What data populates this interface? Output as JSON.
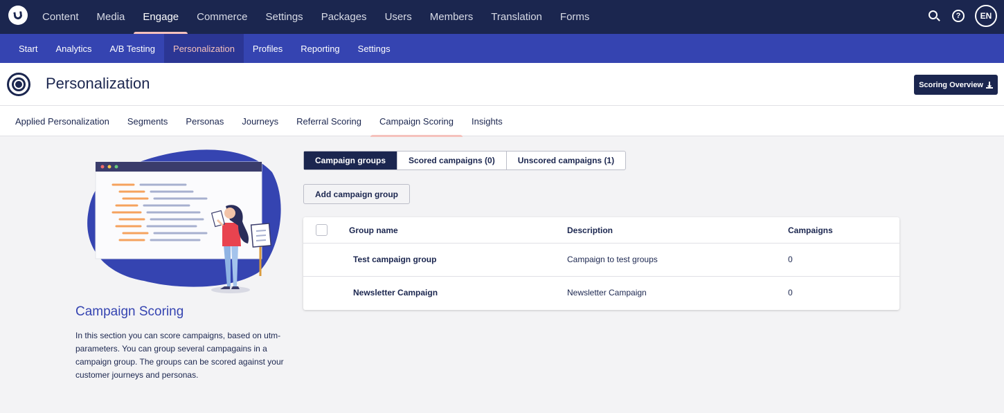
{
  "topnav": {
    "items": [
      "Content",
      "Media",
      "Engage",
      "Commerce",
      "Settings",
      "Packages",
      "Users",
      "Members",
      "Translation",
      "Forms"
    ],
    "active": "Engage",
    "help_glyph": "?",
    "user_initials": "EN"
  },
  "subnav": {
    "items": [
      "Start",
      "Analytics",
      "A/B Testing",
      "Personalization",
      "Profiles",
      "Reporting",
      "Settings"
    ],
    "active": "Personalization"
  },
  "header": {
    "title": "Personalization",
    "scoring_button": "Scoring Overview",
    "icon": "target-icon"
  },
  "tabs": {
    "items": [
      "Applied Personalization",
      "Segments",
      "Personas",
      "Journeys",
      "Referral Scoring",
      "Campaign Scoring",
      "Insights"
    ],
    "active": "Campaign Scoring"
  },
  "side": {
    "title": "Campaign Scoring",
    "description": "In this section you can score campaigns, based on utm-parameters. You can group several campagains in a campaign group. The groups can be scored against your customer journeys and personas."
  },
  "segments": {
    "items": [
      "Campaign groups",
      "Scored campaigns (0)",
      "Unscored campaigns (1)"
    ],
    "active": "Campaign groups"
  },
  "add_button": "Add campaign group",
  "table": {
    "columns": [
      "Group name",
      "Description",
      "Campaigns"
    ],
    "rows": [
      {
        "name": "Test campaign group",
        "description": "Campaign to test groups",
        "campaigns": "0"
      },
      {
        "name": "Newsletter Campaign",
        "description": "Newsletter Campaign",
        "campaigns": "0"
      }
    ]
  },
  "colors": {
    "topbar": "#1b264f",
    "subbar": "#3544b1",
    "accent": "#f5c1bc",
    "background": "#f3f3f5"
  }
}
